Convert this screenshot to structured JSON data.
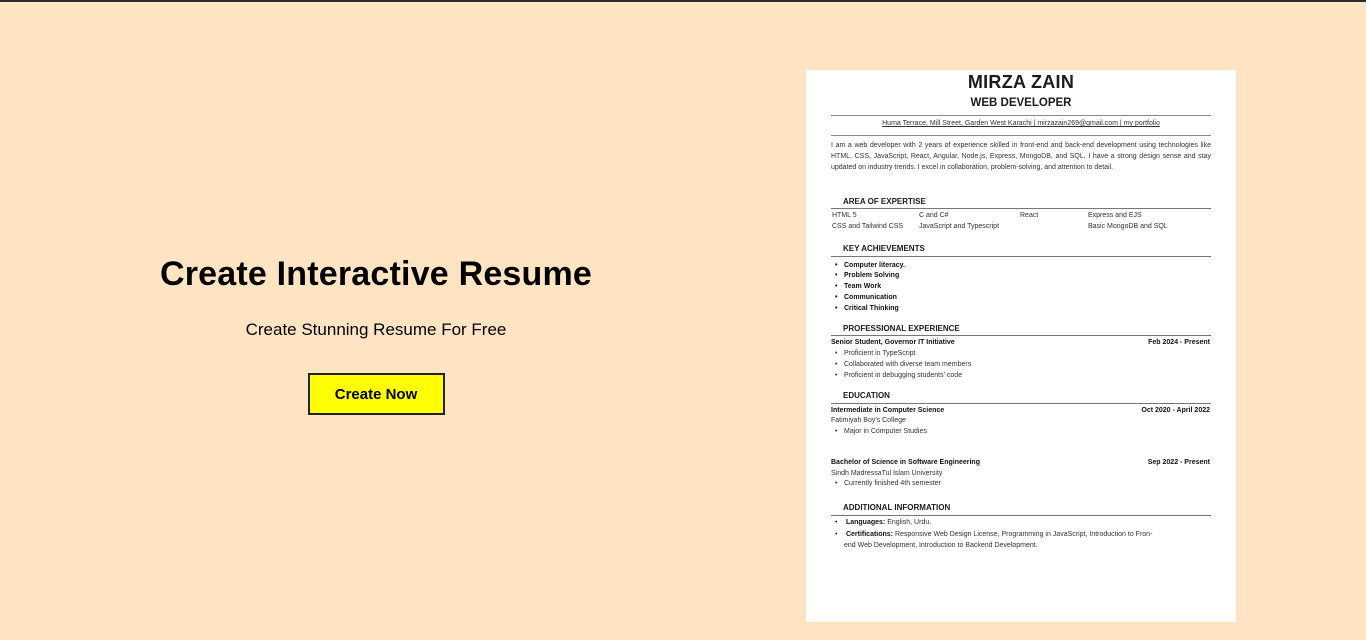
{
  "hero": {
    "title": "Create Interactive Resume",
    "subtitle": "Create Stunning Resume For Free",
    "cta_label": "Create Now"
  },
  "resume": {
    "name": "MIRZA ZAIN",
    "role": "WEB DEVELOPER",
    "contact": "Huma Terrace, Mill Street, Garden West Karachi | mirzazain269@gmail.com | my portfolio",
    "summary": "I am a web developer with 2 years of experience skilled in front-end and back-end development using technologies like HTML, CSS, JavaScript, React, Angular, Node.js, Express, MongoDB, and SQL. I have a strong design sense and stay updated on industry trends. I excel in collaboration, problem-solving, and attention to detail.",
    "expertise": {
      "heading": "AREA OF EXPERTISE",
      "skills": [
        "HTML 5",
        "C and C#",
        "React",
        "Express and EJS",
        "CSS and Tailwind CSS",
        "JavaScript and Typescript",
        "Basic MongoDB and SQL"
      ]
    },
    "achievements": {
      "heading": "KEY ACHIEVEMENTS",
      "items": [
        "Computer literacy.",
        "Problem Solving",
        "Team Work",
        "Communication",
        "Critical Thinking"
      ]
    },
    "experience": {
      "heading": "PROFESSIONAL EXPERIENCE",
      "position": "Senior Student, Governor IT Initiative",
      "dates": "Feb 2024 - Present",
      "bullets": [
        "Proficient in TypeScript",
        "Collaborated with diverse team members",
        "Proficient in debugging students' code"
      ]
    },
    "education": {
      "heading": "EDUCATION",
      "entries": [
        {
          "degree": "Intermediate in Computer Science",
          "dates": "Oct 2020 - April 2022",
          "school": "Fatimiyah Boy's College",
          "bullet": "Major in Computer Studies"
        },
        {
          "degree": "Bachelor of Science in Software Engineering",
          "dates": "Sep 2022 - Present",
          "school": "Sindh MadressaTul Islam University",
          "bullet": "Currently finished 4th semester"
        }
      ]
    },
    "additional": {
      "heading": "ADDITIONAL INFORMATION",
      "languages_label": "Languages:",
      "languages": "English, Urdu.",
      "certifications_label": "Certifications:",
      "certifications_line1": "Responsive Web Design License, Programming in JavaScript, Introduction to Fron-",
      "certifications_line2": "end Web Development, Introduction to Backend Development."
    }
  }
}
